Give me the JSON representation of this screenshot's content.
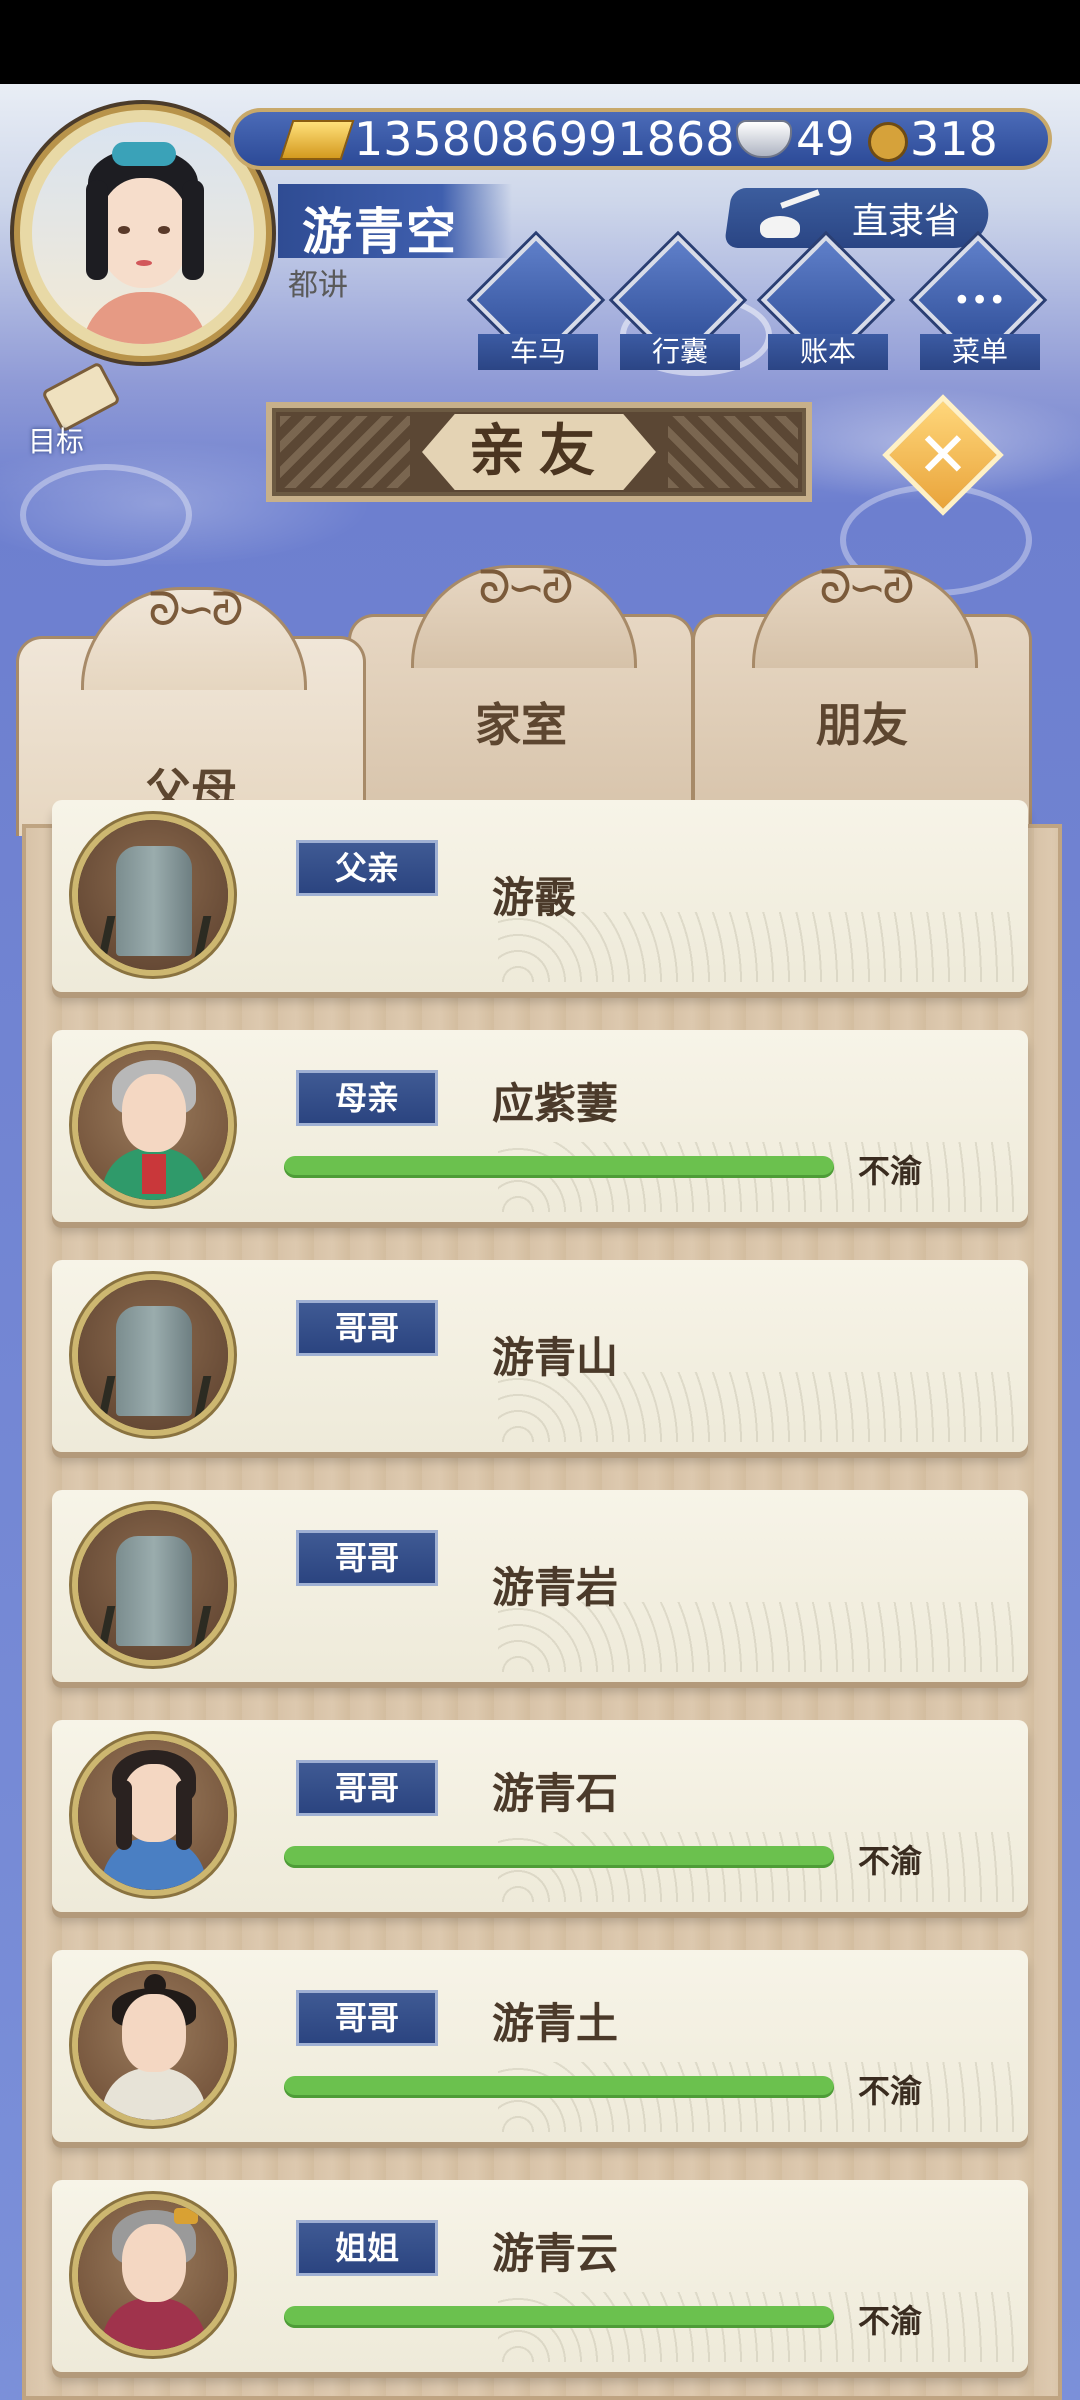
{
  "header": {
    "gold": "1358086991868",
    "silver": "49",
    "coins": "318",
    "player_name": "游青空",
    "player_title": "都讲",
    "province": "直隶省"
  },
  "menu": [
    {
      "label": "车马",
      "icon": "carriage-icon"
    },
    {
      "label": "行囊",
      "icon": "bag-icon"
    },
    {
      "label": "账本",
      "icon": "ledger-icon"
    },
    {
      "label": "菜单",
      "icon": "more-icon"
    }
  ],
  "goal_label": "目标",
  "title": "亲友",
  "tabs": [
    {
      "label": "父母",
      "active": true
    },
    {
      "label": "家室",
      "active": false
    },
    {
      "label": "朋友",
      "active": false
    }
  ],
  "relatives": [
    {
      "relation": "父亲",
      "name": "游霰",
      "deceased": true
    },
    {
      "relation": "母亲",
      "name": "应紫萋",
      "deceased": false,
      "mood": "不渝",
      "bar_fill": 1.0,
      "portrait": "elderly-woman"
    },
    {
      "relation": "哥哥",
      "name": "游青山",
      "deceased": true
    },
    {
      "relation": "哥哥",
      "name": "游青岩",
      "deceased": true
    },
    {
      "relation": "哥哥",
      "name": "游青石",
      "deceased": false,
      "mood": "不渝",
      "bar_fill": 1.0,
      "portrait": "young-man"
    },
    {
      "relation": "哥哥",
      "name": "游青土",
      "deceased": false,
      "mood": "不渝",
      "bar_fill": 1.0,
      "portrait": "man-topknot"
    },
    {
      "relation": "姐姐",
      "name": "游青云",
      "deceased": false,
      "mood": "不渝",
      "bar_fill": 1.0,
      "portrait": "elderly-woman-2"
    }
  ],
  "colors": {
    "bar": "#6bc14e",
    "tag": "#2b4480",
    "banner": "#5b4734",
    "close": "#e9a43b"
  }
}
